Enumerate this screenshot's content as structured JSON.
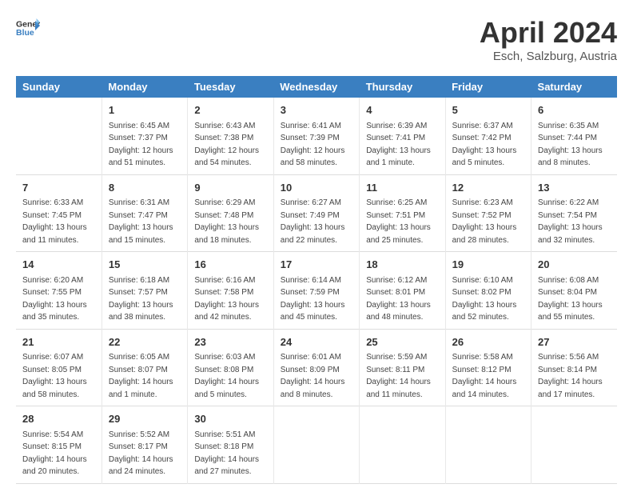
{
  "header": {
    "logo_general": "General",
    "logo_blue": "Blue",
    "title": "April 2024",
    "location": "Esch, Salzburg, Austria"
  },
  "days_of_week": [
    "Sunday",
    "Monday",
    "Tuesday",
    "Wednesday",
    "Thursday",
    "Friday",
    "Saturday"
  ],
  "weeks": [
    [
      {
        "day": "",
        "info": ""
      },
      {
        "day": "1",
        "info": "Sunrise: 6:45 AM\nSunset: 7:37 PM\nDaylight: 12 hours\nand 51 minutes."
      },
      {
        "day": "2",
        "info": "Sunrise: 6:43 AM\nSunset: 7:38 PM\nDaylight: 12 hours\nand 54 minutes."
      },
      {
        "day": "3",
        "info": "Sunrise: 6:41 AM\nSunset: 7:39 PM\nDaylight: 12 hours\nand 58 minutes."
      },
      {
        "day": "4",
        "info": "Sunrise: 6:39 AM\nSunset: 7:41 PM\nDaylight: 13 hours\nand 1 minute."
      },
      {
        "day": "5",
        "info": "Sunrise: 6:37 AM\nSunset: 7:42 PM\nDaylight: 13 hours\nand 5 minutes."
      },
      {
        "day": "6",
        "info": "Sunrise: 6:35 AM\nSunset: 7:44 PM\nDaylight: 13 hours\nand 8 minutes."
      }
    ],
    [
      {
        "day": "7",
        "info": "Sunrise: 6:33 AM\nSunset: 7:45 PM\nDaylight: 13 hours\nand 11 minutes."
      },
      {
        "day": "8",
        "info": "Sunrise: 6:31 AM\nSunset: 7:47 PM\nDaylight: 13 hours\nand 15 minutes."
      },
      {
        "day": "9",
        "info": "Sunrise: 6:29 AM\nSunset: 7:48 PM\nDaylight: 13 hours\nand 18 minutes."
      },
      {
        "day": "10",
        "info": "Sunrise: 6:27 AM\nSunset: 7:49 PM\nDaylight: 13 hours\nand 22 minutes."
      },
      {
        "day": "11",
        "info": "Sunrise: 6:25 AM\nSunset: 7:51 PM\nDaylight: 13 hours\nand 25 minutes."
      },
      {
        "day": "12",
        "info": "Sunrise: 6:23 AM\nSunset: 7:52 PM\nDaylight: 13 hours\nand 28 minutes."
      },
      {
        "day": "13",
        "info": "Sunrise: 6:22 AM\nSunset: 7:54 PM\nDaylight: 13 hours\nand 32 minutes."
      }
    ],
    [
      {
        "day": "14",
        "info": "Sunrise: 6:20 AM\nSunset: 7:55 PM\nDaylight: 13 hours\nand 35 minutes."
      },
      {
        "day": "15",
        "info": "Sunrise: 6:18 AM\nSunset: 7:57 PM\nDaylight: 13 hours\nand 38 minutes."
      },
      {
        "day": "16",
        "info": "Sunrise: 6:16 AM\nSunset: 7:58 PM\nDaylight: 13 hours\nand 42 minutes."
      },
      {
        "day": "17",
        "info": "Sunrise: 6:14 AM\nSunset: 7:59 PM\nDaylight: 13 hours\nand 45 minutes."
      },
      {
        "day": "18",
        "info": "Sunrise: 6:12 AM\nSunset: 8:01 PM\nDaylight: 13 hours\nand 48 minutes."
      },
      {
        "day": "19",
        "info": "Sunrise: 6:10 AM\nSunset: 8:02 PM\nDaylight: 13 hours\nand 52 minutes."
      },
      {
        "day": "20",
        "info": "Sunrise: 6:08 AM\nSunset: 8:04 PM\nDaylight: 13 hours\nand 55 minutes."
      }
    ],
    [
      {
        "day": "21",
        "info": "Sunrise: 6:07 AM\nSunset: 8:05 PM\nDaylight: 13 hours\nand 58 minutes."
      },
      {
        "day": "22",
        "info": "Sunrise: 6:05 AM\nSunset: 8:07 PM\nDaylight: 14 hours\nand 1 minute."
      },
      {
        "day": "23",
        "info": "Sunrise: 6:03 AM\nSunset: 8:08 PM\nDaylight: 14 hours\nand 5 minutes."
      },
      {
        "day": "24",
        "info": "Sunrise: 6:01 AM\nSunset: 8:09 PM\nDaylight: 14 hours\nand 8 minutes."
      },
      {
        "day": "25",
        "info": "Sunrise: 5:59 AM\nSunset: 8:11 PM\nDaylight: 14 hours\nand 11 minutes."
      },
      {
        "day": "26",
        "info": "Sunrise: 5:58 AM\nSunset: 8:12 PM\nDaylight: 14 hours\nand 14 minutes."
      },
      {
        "day": "27",
        "info": "Sunrise: 5:56 AM\nSunset: 8:14 PM\nDaylight: 14 hours\nand 17 minutes."
      }
    ],
    [
      {
        "day": "28",
        "info": "Sunrise: 5:54 AM\nSunset: 8:15 PM\nDaylight: 14 hours\nand 20 minutes."
      },
      {
        "day": "29",
        "info": "Sunrise: 5:52 AM\nSunset: 8:17 PM\nDaylight: 14 hours\nand 24 minutes."
      },
      {
        "day": "30",
        "info": "Sunrise: 5:51 AM\nSunset: 8:18 PM\nDaylight: 14 hours\nand 27 minutes."
      },
      {
        "day": "",
        "info": ""
      },
      {
        "day": "",
        "info": ""
      },
      {
        "day": "",
        "info": ""
      },
      {
        "day": "",
        "info": ""
      }
    ]
  ]
}
